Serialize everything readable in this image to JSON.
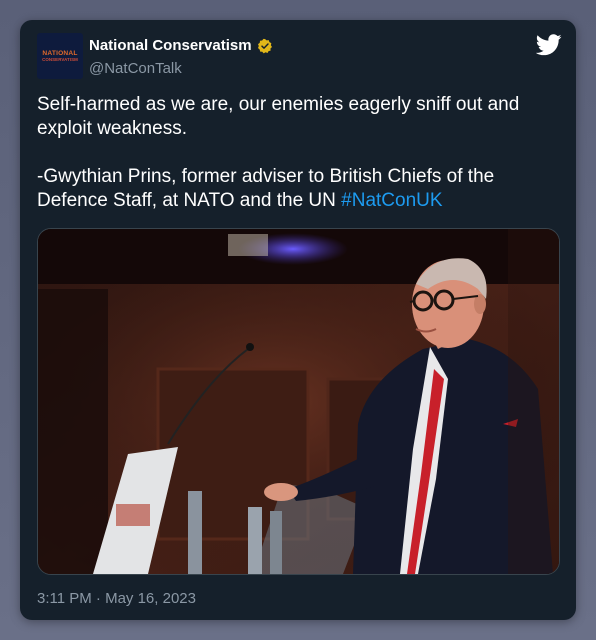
{
  "tweet": {
    "display_name": "National Conservatism",
    "handle": "@NatConTalk",
    "avatar_text": [
      "NATIONAL",
      "CONSERVATISM"
    ],
    "text_line1": "Self-harmed as we are, our enemies eagerly sniff out and exploit weakness.",
    "text_line2_prefix": "-Gwythian Prins, former adviser to British Chiefs of the Defence Staff, at NATO and the UN ",
    "hashtag": "#NatConUK",
    "timestamp": "3:11 PM · May 16, 2023"
  },
  "icons": {
    "verified": "verified-gold-badge-icon",
    "brand": "twitter-bird-icon"
  },
  "colors": {
    "card_bg": "#15202b",
    "link": "#1d9bf0",
    "secondary_text": "#8b98a5",
    "verified_badge": "#e2b719"
  }
}
